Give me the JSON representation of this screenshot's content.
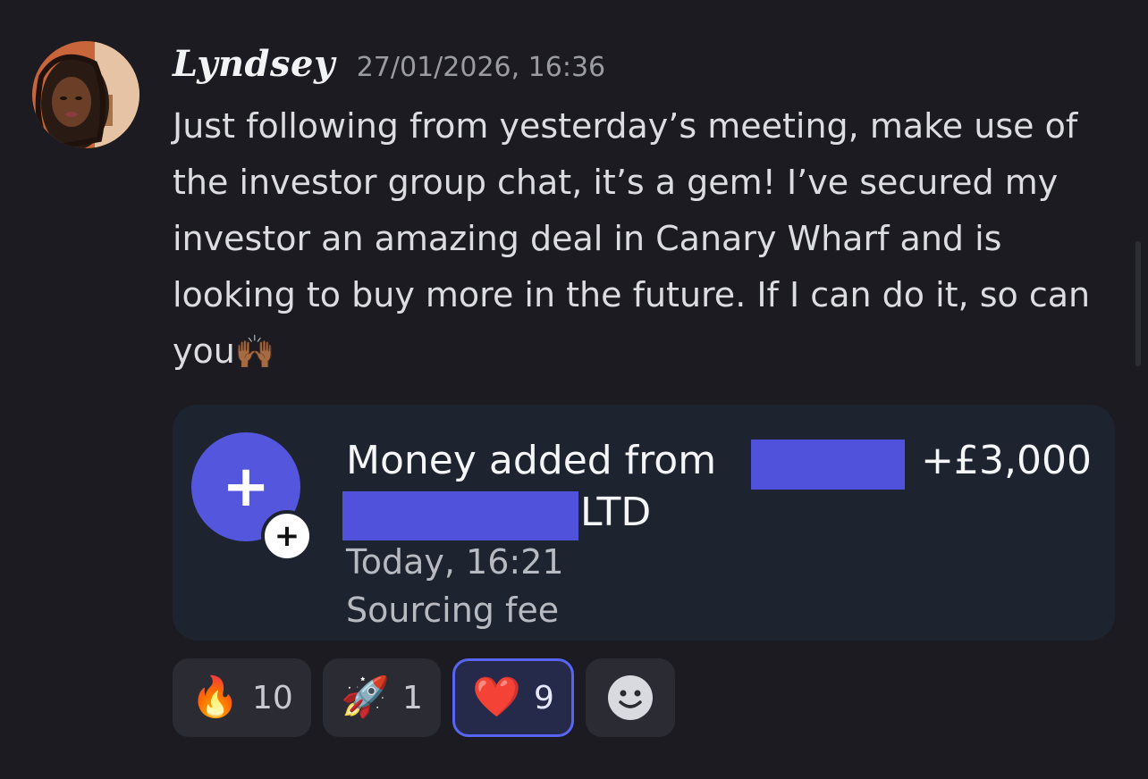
{
  "message": {
    "author": "Lyndsey",
    "timestamp": "27/01/2026, 16:36",
    "text": "Just following from yesterday’s meeting, make use of the investor group chat, it’s a gem! I’ve secured my investor an amazing deal in Canary Wharf and is looking to buy more in the future. If I can do it, so can you",
    "text_emoji": "🙌🏾"
  },
  "card": {
    "icon": "plus-icon",
    "badge_icon": "plus-circle-icon",
    "title": "Money added from",
    "amount": "+£3,000",
    "company_suffix": "LTD",
    "time": "Today, 16:21",
    "description": "Sourcing fee",
    "accent_color": "#5457dd",
    "redaction_color": "#5052dc"
  },
  "reactions": [
    {
      "emoji": "🔥",
      "count": "10",
      "active": false
    },
    {
      "emoji": "🚀",
      "count": "1",
      "active": false
    },
    {
      "emoji": "❤️",
      "count": "9",
      "active": true
    }
  ],
  "add_reaction": {
    "icon": "smiley-icon"
  }
}
